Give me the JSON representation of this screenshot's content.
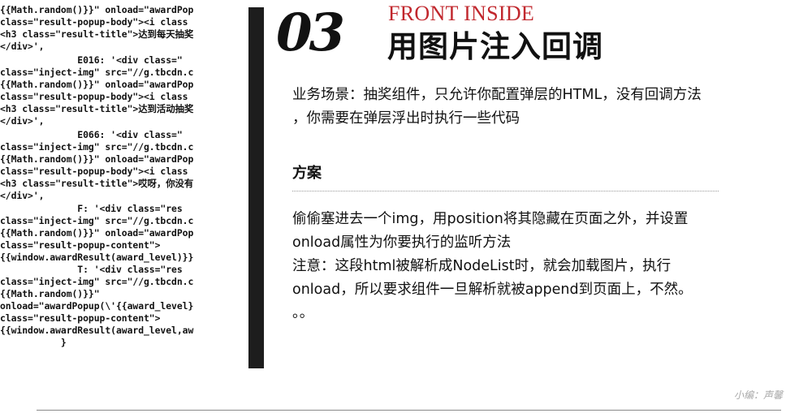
{
  "code_lines": [
    "{{Math.random()}}\" onload=\"awardPop",
    "class=\"result-popup-body\"><i class",
    "<h3 class=\"result-title\">达到每天抽奖",
    "</div>',",
    "              E016: '<div class=\"",
    "class=\"inject-img\" src=\"//g.tbcdn.c",
    "{{Math.random()}}\" onload=\"awardPop",
    "class=\"result-popup-body\"><i class",
    "<h3 class=\"result-title\">达到活动抽奖",
    "</div>',",
    "              E066: '<div class=\"",
    "class=\"inject-img\" src=\"//g.tbcdn.c",
    "{{Math.random()}}\" onload=\"awardPop",
    "class=\"result-popup-body\"><i class",
    "<h3 class=\"result-title\">哎呀，你没有",
    "</div>',",
    "              F: '<div class=\"res",
    "class=\"inject-img\" src=\"//g.tbcdn.c",
    "{{Math.random()}}\" onload=\"awardPop",
    "class=\"result-popup-content\">",
    "{{window.awardResult(award_level)}}",
    "              T: '<div class=\"res",
    "class=\"inject-img\" src=\"//g.tbcdn.c",
    "{{Math.random()}}\"",
    "onload=\"awardPopup(\\'{{award_level}",
    "class=\"result-popup-content\">",
    "{{window.awardResult(award_level,aw",
    "           }"
  ],
  "header": {
    "number": "03",
    "subtitle": "FRONT INSIDE",
    "title": "用图片注入回调"
  },
  "scenario": [
    "业务场景：抽奖组件，只允许你配置弹层的HTML，没有回调方法",
    "，你需要在弹层浮出时执行一些代码"
  ],
  "solution": {
    "heading": "方案",
    "lines": [
      "偷偷塞进去一个img，用position将其隐藏在页面之外，并设置",
      "onload属性为你要执行的监听方法",
      "注意：这段html被解析成NodeList时，就会加载图片，执行",
      "onload，所以要求组件一旦解析就被append到页面上，不然。",
      "。。"
    ]
  },
  "footer": {
    "editor": "小编：声馨"
  }
}
